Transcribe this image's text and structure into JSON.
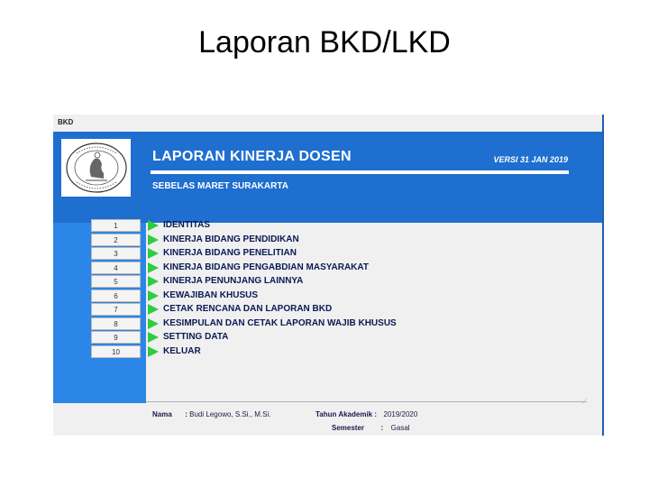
{
  "slide": {
    "title": "Laporan BKD/LKD"
  },
  "window": {
    "title": "BKD"
  },
  "banner": {
    "title": "LAPORAN KINERJA DOSEN",
    "version": "VERSI 31 JAN 2019",
    "subtitle": "SEBELAS MARET SURAKARTA"
  },
  "menu": {
    "items": [
      {
        "number": "1",
        "label": "IDENTITAS"
      },
      {
        "number": "2",
        "label": "KINERJA BIDANG PENDIDIKAN"
      },
      {
        "number": "3",
        "label": "KINERJA BIDANG PENELITIAN"
      },
      {
        "number": "4",
        "label": "KINERJA BIDANG PENGABDIAN MASYARAKAT"
      },
      {
        "number": "5",
        "label": "KINERJA PENUNJANG LAINNYA"
      },
      {
        "number": "6",
        "label": "KEWAJIBAN KHUSUS"
      },
      {
        "number": "7",
        "label": "CETAK RENCANA DAN LAPORAN BKD"
      },
      {
        "number": "8",
        "label": "KESIMPULAN DAN CETAK LAPORAN WAJIB KHUSUS"
      },
      {
        "number": "9",
        "label": "SETTING DATA"
      },
      {
        "number": "10",
        "label": "KELUAR"
      }
    ]
  },
  "footer": {
    "name_label": "Nama",
    "name_sep": ":",
    "name_value": "Budi Legowo, S.Si., M.Si.",
    "year_label": "Tahun Akademik",
    "year_sep": ":",
    "year_value": "2019/2020",
    "semester_label": "Semester",
    "semester_sep": ":",
    "semester_value": "Gasal"
  },
  "colors": {
    "banner": "#1e6fd0",
    "strip": "#2b86e8",
    "arrow": "#2ecc40",
    "menu_text": "#0a1a55"
  },
  "icons": {
    "logo": "university-seal-icon",
    "arrow": "play-arrow-icon"
  }
}
